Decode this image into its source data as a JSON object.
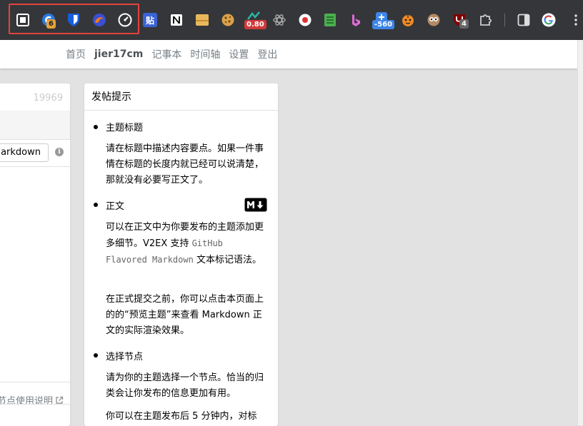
{
  "extensions": {
    "badge_6": "6",
    "tieba": "贴",
    "badge_080": "0.80",
    "badge_560": "-560",
    "badge_4": "4"
  },
  "nav": {
    "home": "首页",
    "user": "jier17cm",
    "notes": "记事本",
    "timeline": "时间轴",
    "settings": "设置",
    "logout": "登出"
  },
  "editor": {
    "char_count": "19969",
    "syntax_value": "Markdown",
    "node_help_link": "节点使用说明"
  },
  "tips": {
    "header": "发帖提示",
    "title_item": "主题标题",
    "title_desc": "请在标题中描述内容要点。如果一件事情在标题的长度内就已经可以说清楚，那就没有必要写正文了。",
    "body_item": "正文",
    "body_desc_1": "可以在正文中为你要发布的主题添加更多细节。V2EX 支持",
    "body_desc_code": "GitHub Flavored Markdown",
    "body_desc_2": "文本标记语法。",
    "preview_desc": "在正式提交之前，你可以点击本页面上的的“预览主题”来查看 Markdown 正文的实际渲染效果。",
    "node_item": "选择节点",
    "node_desc": "请为你的主题选择一个节点。恰当的归类会让你发布的信息更加有用。",
    "edit_desc": "你可以在主题发布后 5 分钟内，对标"
  },
  "colors": {
    "toolbar_bg": "#35363a",
    "highlight_border": "#e0453c",
    "nav_text": "#778087",
    "page_bg": "#e2e2e2"
  }
}
